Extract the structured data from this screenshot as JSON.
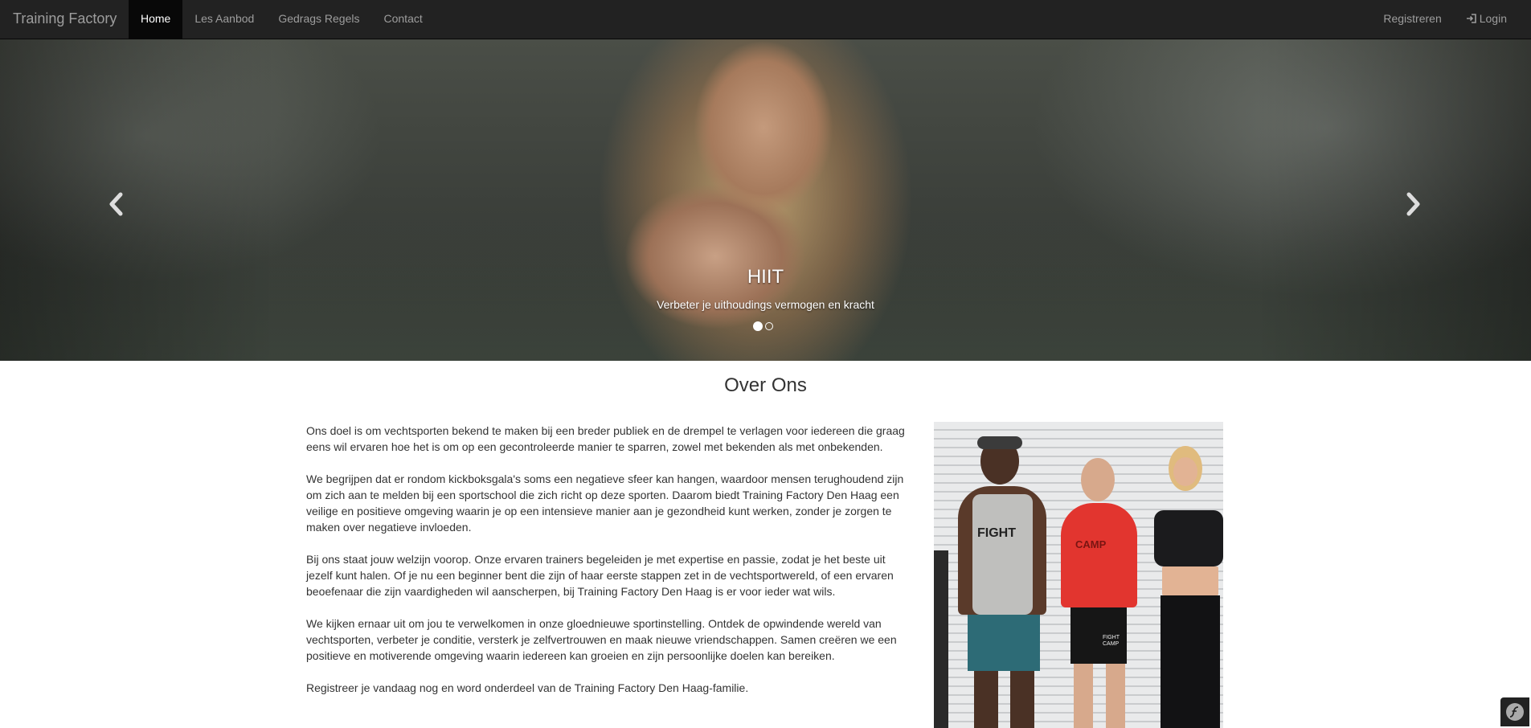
{
  "navbar": {
    "brand": "Training Factory",
    "left_items": [
      {
        "label": "Home",
        "active": true
      },
      {
        "label": "Les Aanbod",
        "active": false
      },
      {
        "label": "Gedrags Regels",
        "active": false
      },
      {
        "label": "Contact",
        "active": false
      }
    ],
    "right_items": [
      {
        "label": "Registreren",
        "icon": null
      },
      {
        "label": "Login",
        "icon": "login-icon"
      }
    ]
  },
  "carousel": {
    "caption_title": "HIIT",
    "caption_text": "Verbeter je uithoudings vermogen en kracht",
    "slide_count": 2,
    "active_index": 0,
    "prev_icon": "chevron-left-icon",
    "next_icon": "chevron-right-icon"
  },
  "about": {
    "title": "Over Ons",
    "paragraphs": [
      "Ons doel is om vechtsporten bekend te maken bij een breder publiek en de drempel te verlagen voor iedereen die graag eens wil ervaren hoe het is om op een gecontroleerde manier te sparren, zowel met bekenden als met onbekenden.",
      "We begrijpen dat er rondom kickboksgala's soms een negatieve sfeer kan hangen, waardoor mensen terughoudend zijn om zich aan te melden bij een sportschool die zich richt op deze sporten. Daarom biedt Training Factory Den Haag een veilige en positieve omgeving waarin je op een intensieve manier aan je gezondheid kunt werken, zonder je zorgen te maken over negatieve invloeden.",
      "Bij ons staat jouw welzijn voorop. Onze ervaren trainers begeleiden je met expertise en passie, zodat je het beste uit jezelf kunt halen. Of je nu een beginner bent die zijn of haar eerste stappen zet in de vechtsportwereld, of een ervaren beoefenaar die zijn vaardigheden wil aanscherpen, bij Training Factory Den Haag is er voor ieder wat wils.",
      "We kijken ernaar uit om jou te verwelkomen in onze gloednieuwe sportinstelling. Ontdek de opwindende wereld van vechtsporten, verbeter je conditie, versterk je zelfvertrouwen en maak nieuwe vriendschappen. Samen creëren we een positieve en motiverende omgeving waarin iedereen kan groeien en zijn persoonlijke doelen kan bereiken.",
      "Registreer je vandaag nog en word onderdeel van de Training Factory Den Haag-familie."
    ],
    "photo_shirt_texts": [
      "FIGHT",
      "CAMP",
      "FIGHT CAMP"
    ]
  },
  "badge": {
    "icon": "symfony-icon"
  },
  "colors": {
    "navbar_bg": "#222222",
    "nav_active_bg": "#080808",
    "nav_text": "#9d9d9d",
    "body_text": "#333333"
  }
}
